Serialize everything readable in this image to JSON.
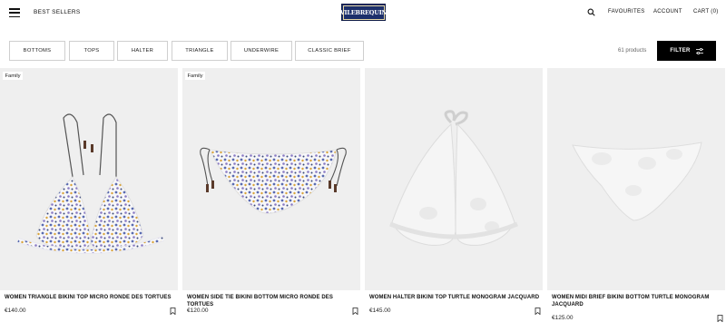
{
  "header": {
    "nav_left": "BEST SELLERS",
    "logo": "VILEBREQUIN",
    "favourites": "FAVOURITES",
    "account": "ACCOUNT",
    "cart": "CART (0)"
  },
  "filters": {
    "chips": [
      "BOTTOMS",
      "TOPS",
      "HALTER",
      "TRIANGLE",
      "UNDERWIRE",
      "CLASSIC BRIEF"
    ],
    "count": "61 products",
    "filter_label": "FILTER"
  },
  "products": [
    {
      "tag": "Family",
      "title": "WOMEN TRIANGLE BIKINI TOP MICRO RONDE DES TORTUES",
      "price": "€140.00"
    },
    {
      "tag": "Family",
      "title": "WOMEN SIDE TIE BIKINI BOTTOM MICRO RONDE DES TORTUES",
      "price": "€120.00"
    },
    {
      "tag": "",
      "title": "WOMEN HALTER BIKINI TOP TURTLE MONOGRAM JACQUARD",
      "price": "€145.00"
    },
    {
      "tag": "",
      "title": "WOMEN MIDI BRIEF BIKINI BOTTOM TURTLE MONOGRAM JACQUARD",
      "price": "€125.00"
    }
  ],
  "icons": {
    "menu": "hamburger-menu-icon",
    "search": "search-icon",
    "filter": "sliders-icon",
    "bookmark": "bookmark-icon"
  },
  "colors": {
    "logo_bg": "#1c2f6b",
    "filter_bg": "#000000",
    "card_bg": "#efefef"
  }
}
